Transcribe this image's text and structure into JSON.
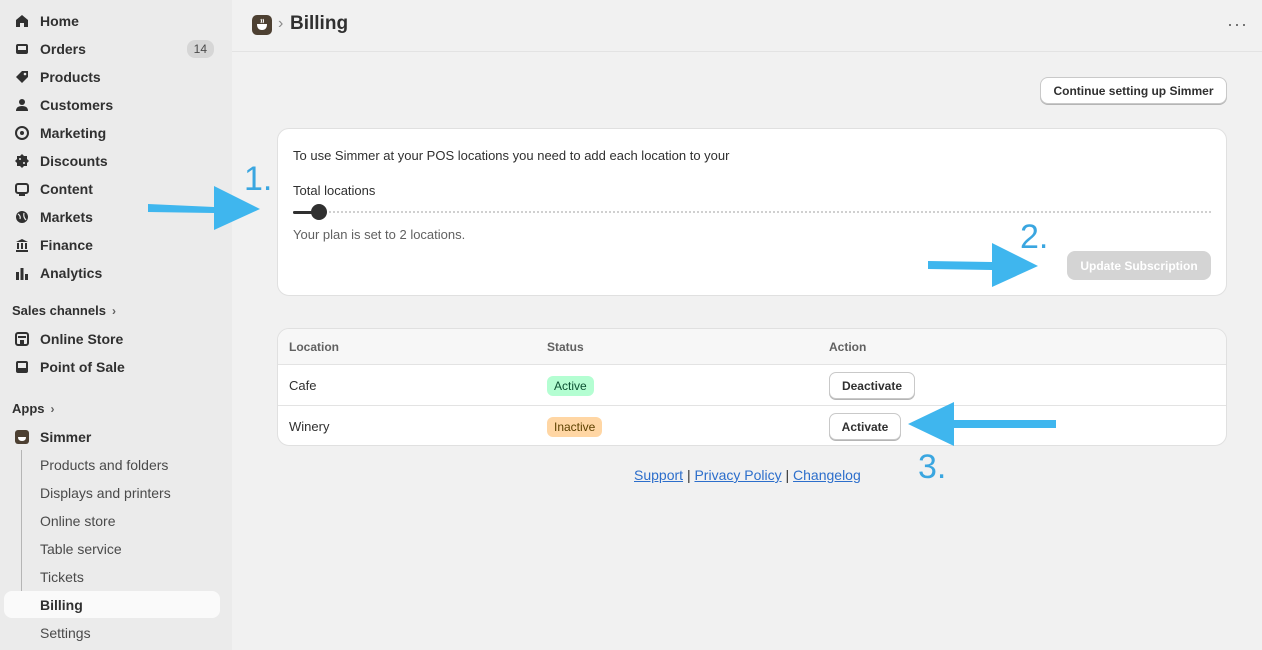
{
  "sidebar": {
    "items": [
      {
        "label": "Home",
        "icon": "home-icon"
      },
      {
        "label": "Orders",
        "icon": "inbox-icon",
        "badge": "14"
      },
      {
        "label": "Products",
        "icon": "tag-icon"
      },
      {
        "label": "Customers",
        "icon": "person-icon"
      },
      {
        "label": "Marketing",
        "icon": "target-icon"
      },
      {
        "label": "Discounts",
        "icon": "discount-icon"
      },
      {
        "label": "Content",
        "icon": "content-icon"
      },
      {
        "label": "Markets",
        "icon": "globe-icon"
      },
      {
        "label": "Finance",
        "icon": "bank-icon"
      },
      {
        "label": "Analytics",
        "icon": "bar-chart-icon"
      }
    ],
    "sales_channels_label": "Sales channels",
    "sales_channels": [
      {
        "label": "Online Store",
        "icon": "store-icon"
      },
      {
        "label": "Point of Sale",
        "icon": "pos-icon"
      }
    ],
    "apps_label": "Apps",
    "app": {
      "label": "Simmer",
      "icon": "simmer-app-icon"
    },
    "app_subitems": [
      "Products and folders",
      "Displays and printers",
      "Online store",
      "Table service",
      "Tickets",
      "Billing",
      "Settings"
    ]
  },
  "header": {
    "title": "Billing"
  },
  "main": {
    "continue_button": "Continue setting up Simmer",
    "intro": "To use Simmer at your POS locations you need to add each location to your",
    "slider_label": "Total locations",
    "slider_value": 2,
    "plan_text": "Your plan is set to 2 locations.",
    "update_button": "Update Subscription",
    "table": {
      "headers": [
        "Location",
        "Status",
        "Action"
      ],
      "rows": [
        {
          "location": "Cafe",
          "status": "Active",
          "action": "Deactivate"
        },
        {
          "location": "Winery",
          "status": "Inactive",
          "action": "Activate"
        }
      ]
    },
    "footer": {
      "support": "Support",
      "privacy": "Privacy Policy",
      "changelog": "Changelog",
      "separator": "|"
    }
  },
  "annotations": {
    "one": "1.",
    "two": "2.",
    "three": "3.",
    "arrow_color": "#3fb6ee"
  }
}
